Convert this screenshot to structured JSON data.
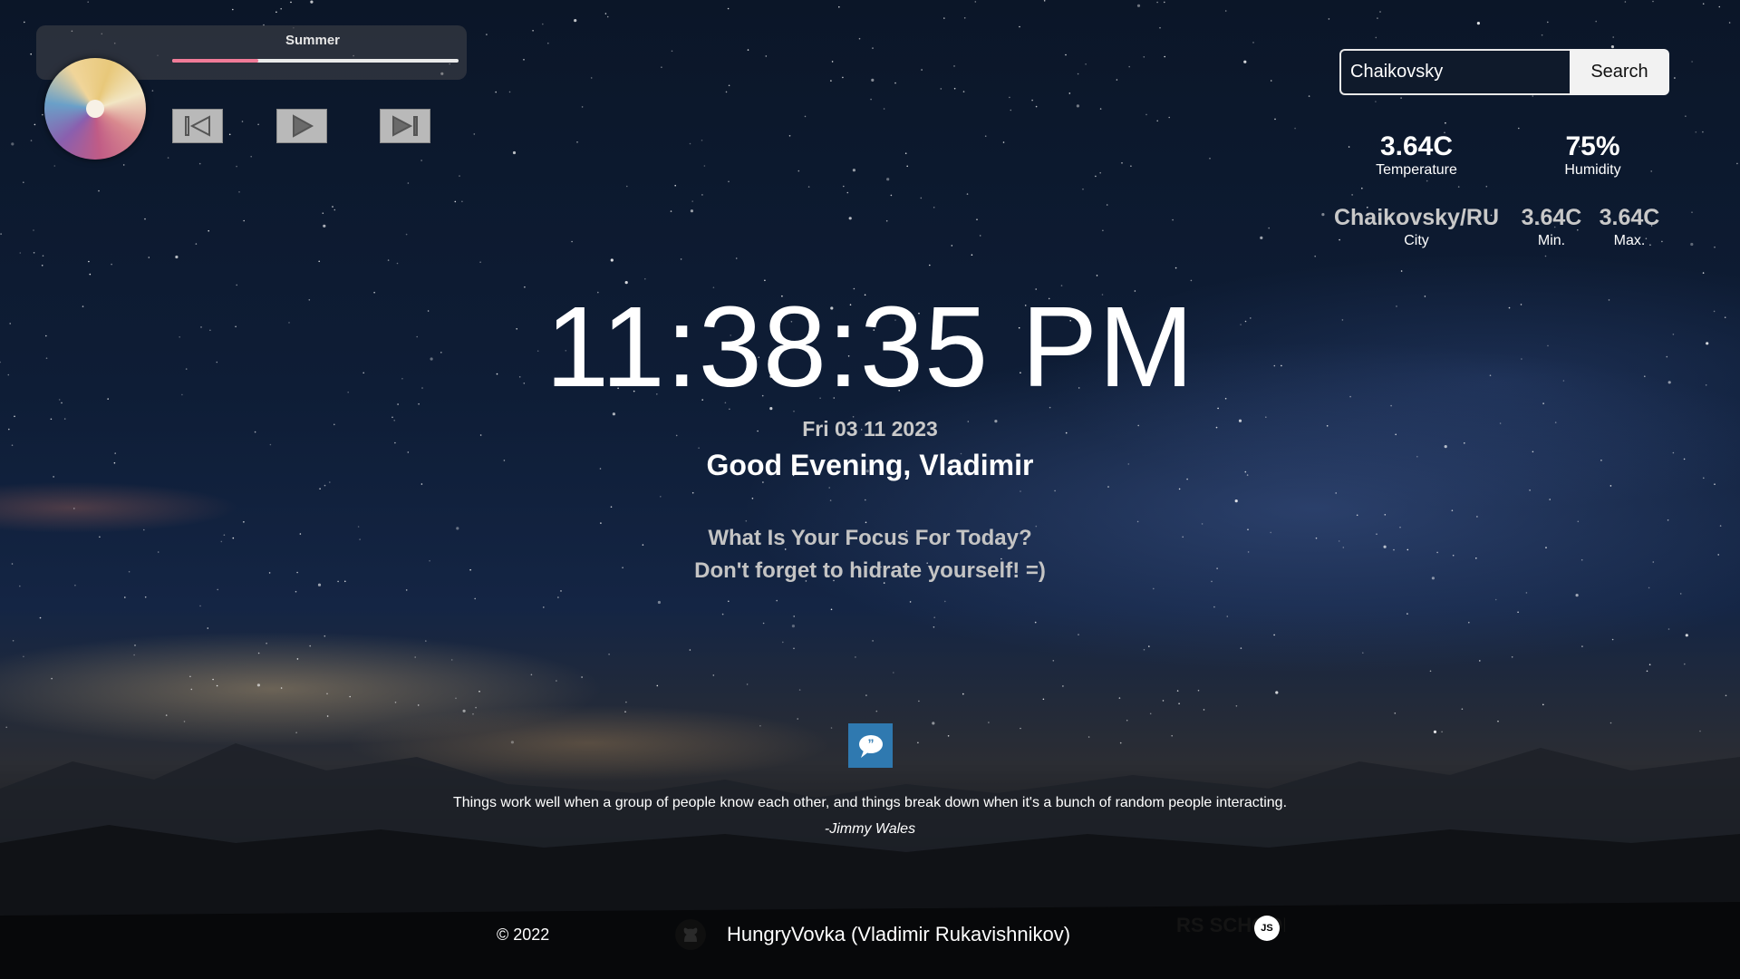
{
  "player": {
    "track_title": "Summer",
    "progress": 0.3,
    "controls": {
      "prev_icon": "skip-previous-icon",
      "play_icon": "play-icon",
      "next_icon": "skip-next-icon"
    }
  },
  "search": {
    "value": "Chaikovsky",
    "button_label": "Search"
  },
  "weather": {
    "temperature": {
      "value": "3.64C",
      "label": "Temperature"
    },
    "humidity": {
      "value": "75%",
      "label": "Humidity"
    },
    "city": {
      "value": "Chaikovsky/RU",
      "label": "City"
    },
    "min": {
      "value": "3.64C",
      "label": "Min."
    },
    "max": {
      "value": "3.64C",
      "label": "Max."
    }
  },
  "clock": {
    "time": "11:38:35 PM",
    "date": "Fri 03 11 2023"
  },
  "greeting": "Good Evening, Vladimir",
  "focus": {
    "question": "What Is Your Focus For Today?",
    "answer": "Don't forget to hidrate yourself! =)"
  },
  "quote": {
    "icon": "quote-bubble-icon",
    "text": "Things work well when a group of people know each other, and things break down when it's a bunch of random people interacting.",
    "author": "-Jimmy Wales"
  },
  "footer": {
    "copyright": "© 2022",
    "github_icon": "github-icon",
    "author": "HungryVovka (Vladimir Rukavishnikov)",
    "school_logo_text": "RS SCHOOL",
    "school_badge": "JS"
  },
  "colors": {
    "accent": "#f07b98",
    "quote_button": "#2f79b0"
  }
}
